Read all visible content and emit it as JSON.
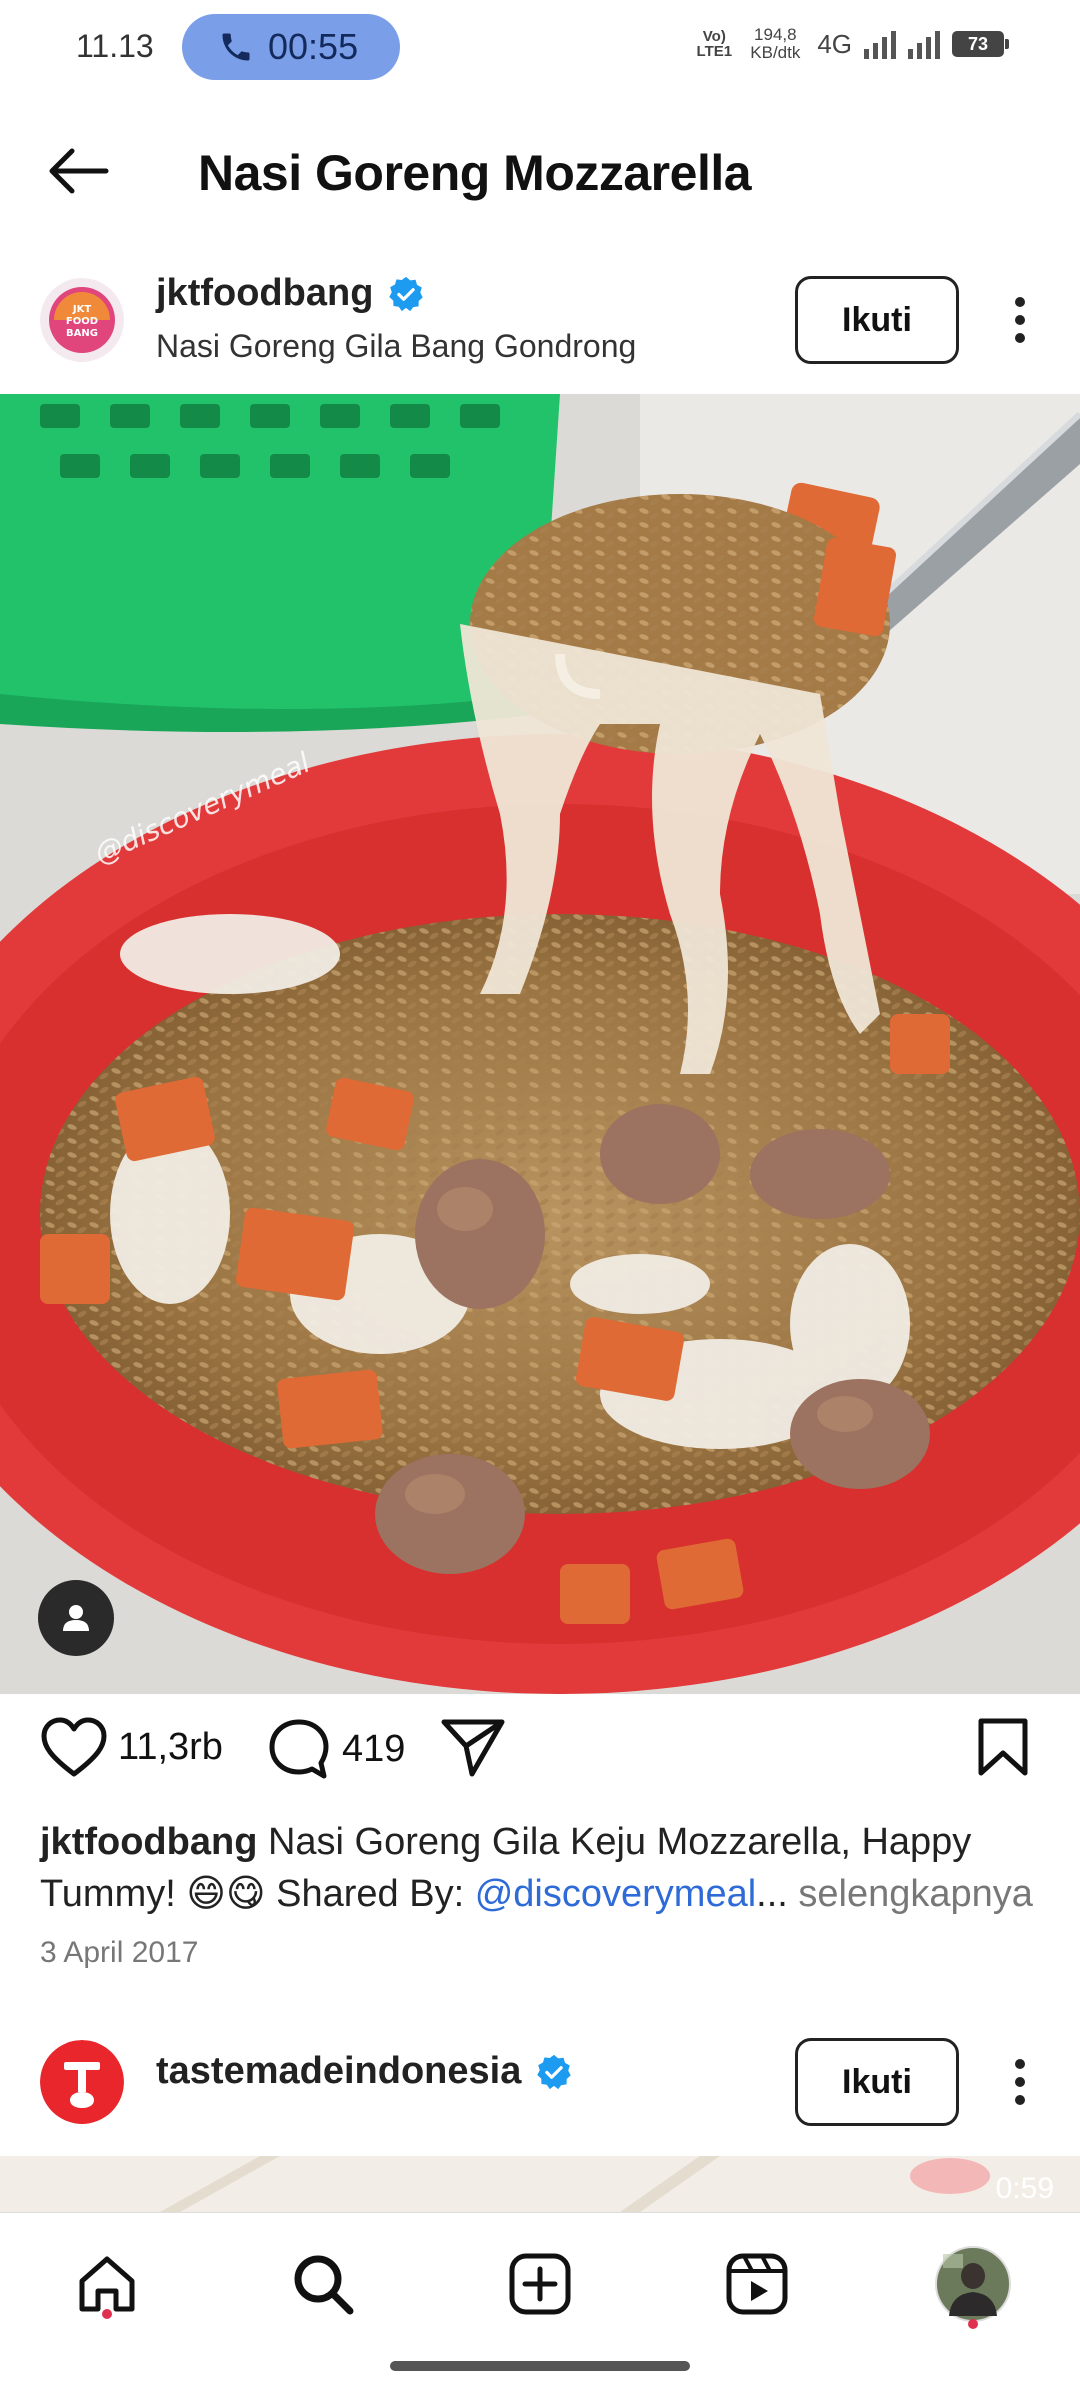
{
  "status_bar": {
    "time": "11.13",
    "call_timer": "00:55",
    "volte": "Vo) LTE1",
    "speed_value": "194,8",
    "speed_unit": "KB/dtk",
    "network": "4G",
    "battery": "73"
  },
  "header": {
    "title": "Nasi Goreng Mozzarella"
  },
  "post": {
    "username": "jktfoodbang",
    "subtitle": "Nasi Goreng Gila Bang Gondrong",
    "follow_label": "Ikuti",
    "avatar_text": "JKT FOOD BANG",
    "image_watermark": "@discoverymeal",
    "likes": "11,3rb",
    "comments": "419",
    "caption_user": "jktfoodbang",
    "caption_text": "Nasi Goreng Gila Keju Mozzarella, Happy Tummy! 😄😋 Shared By:",
    "caption_mention": "@discoverymeal",
    "caption_ellipsis": "...",
    "caption_more": "selengkapnya",
    "date": "3 April 2017"
  },
  "next_post": {
    "username": "tastemadeindonesia",
    "follow_label": "Ikuti",
    "duration": "0:59"
  },
  "bottom_nav": {
    "items": [
      "home",
      "search",
      "create",
      "reels",
      "profile"
    ]
  },
  "colors": {
    "verified_blue": "#1d9bf0",
    "mention_blue": "#2e6bd6",
    "call_pill": "#7a9fe8",
    "plate_red": "#e23a3a",
    "tastemade_red": "#e8262b"
  }
}
